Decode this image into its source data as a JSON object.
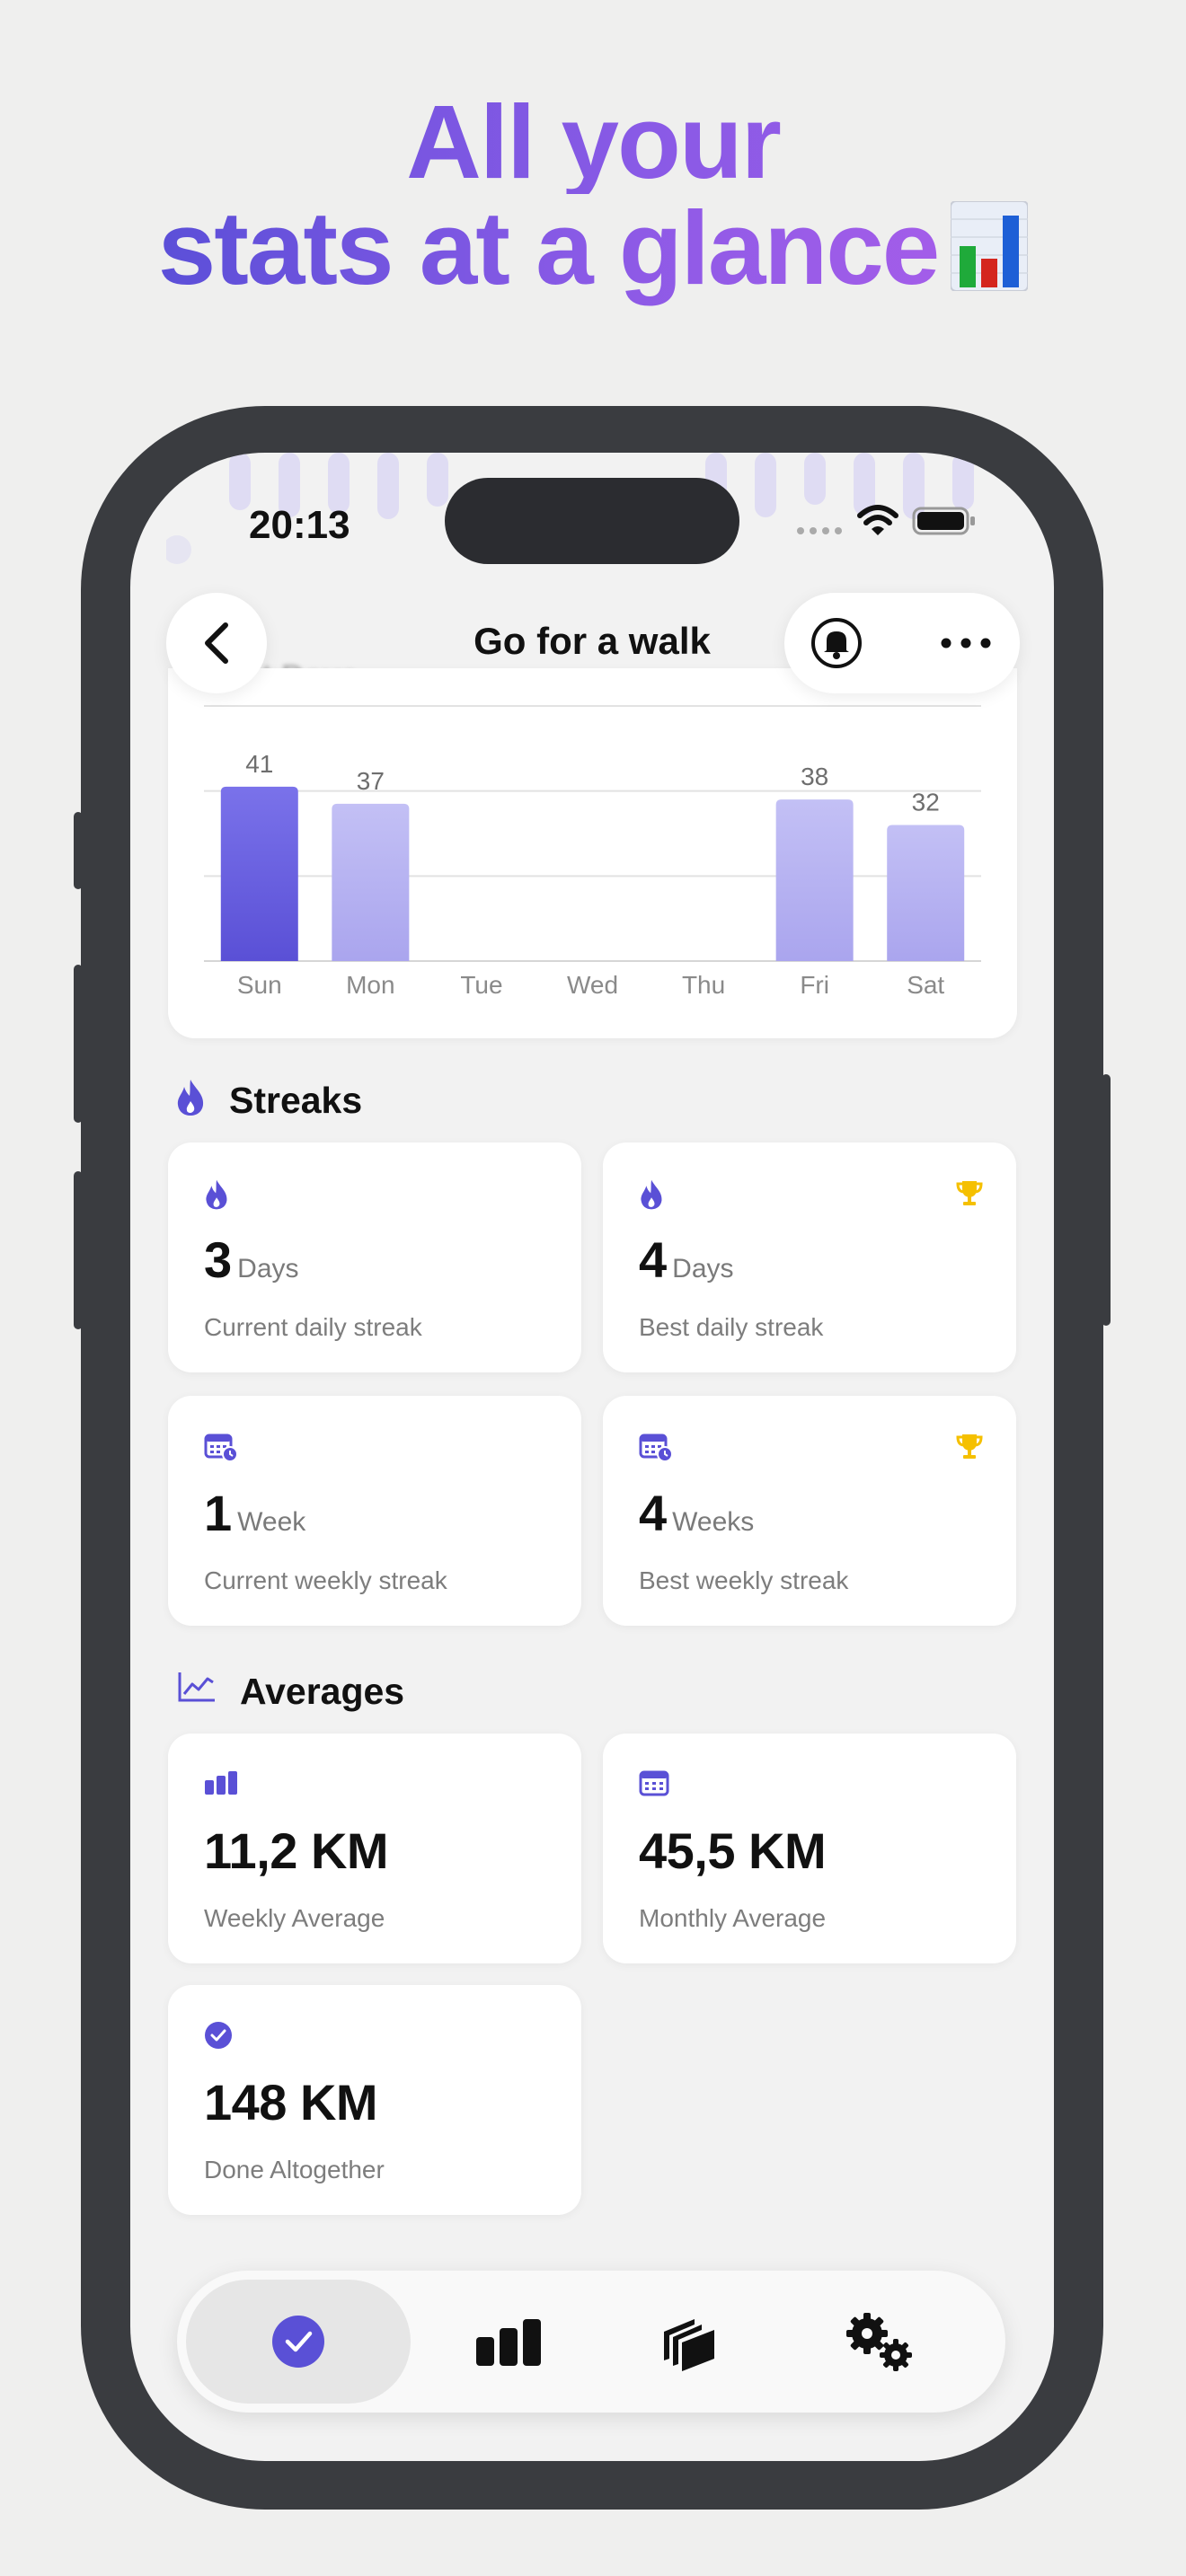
{
  "headline": {
    "line1": "All your",
    "line2": "stats at a glance"
  },
  "status": {
    "time": "20:13"
  },
  "nav": {
    "title": "Go for a walk",
    "ghost_title": "Best Days"
  },
  "chart_data": {
    "type": "bar",
    "title": "Best Days",
    "categories": [
      "Sun",
      "Mon",
      "Tue",
      "Wed",
      "Thu",
      "Fri",
      "Sat"
    ],
    "values": [
      41,
      37,
      0,
      0,
      0,
      38,
      32
    ],
    "data_labels": [
      "41",
      "37",
      "",
      "",
      "",
      "38",
      "32"
    ],
    "ylim": [
      0,
      60
    ],
    "grid": true,
    "colors": {
      "highlight": "#5a50d6",
      "normal": "#aaa5ee"
    }
  },
  "streaks": {
    "title": "Streaks",
    "cards": [
      {
        "value": "3",
        "unit": "Days",
        "label": "Current daily streak",
        "icon": "flame-icon",
        "trophy": false
      },
      {
        "value": "4",
        "unit": "Days",
        "label": "Best daily streak",
        "icon": "flame-icon",
        "trophy": true
      },
      {
        "value": "1",
        "unit": "Week",
        "label": "Current weekly streak",
        "icon": "calendar-clock-icon",
        "trophy": false
      },
      {
        "value": "4",
        "unit": "Weeks",
        "label": "Best weekly streak",
        "icon": "calendar-clock-icon",
        "trophy": true
      }
    ]
  },
  "averages": {
    "title": "Averages",
    "cards": [
      {
        "value": "11,2 KM",
        "label": "Weekly Average",
        "icon": "bar-chart-icon"
      },
      {
        "value": "45,5 KM",
        "label": "Monthly Average",
        "icon": "calendar-icon"
      },
      {
        "value": "148 KM",
        "label": "Done Altogether",
        "icon": "checkmark-circle-icon"
      }
    ]
  },
  "tabbar": {
    "tabs": [
      {
        "name": "habits",
        "icon": "checkmark-circle-icon",
        "active": true
      },
      {
        "name": "stats",
        "icon": "bar-chart-icon",
        "active": false
      },
      {
        "name": "archive",
        "icon": "stack-icon",
        "active": false
      },
      {
        "name": "settings",
        "icon": "gears-icon",
        "active": false
      }
    ]
  },
  "colors": {
    "accent": "#5a50d6",
    "trophy": "#f5c000",
    "text": "#111111",
    "muted": "#7d7d7d"
  }
}
